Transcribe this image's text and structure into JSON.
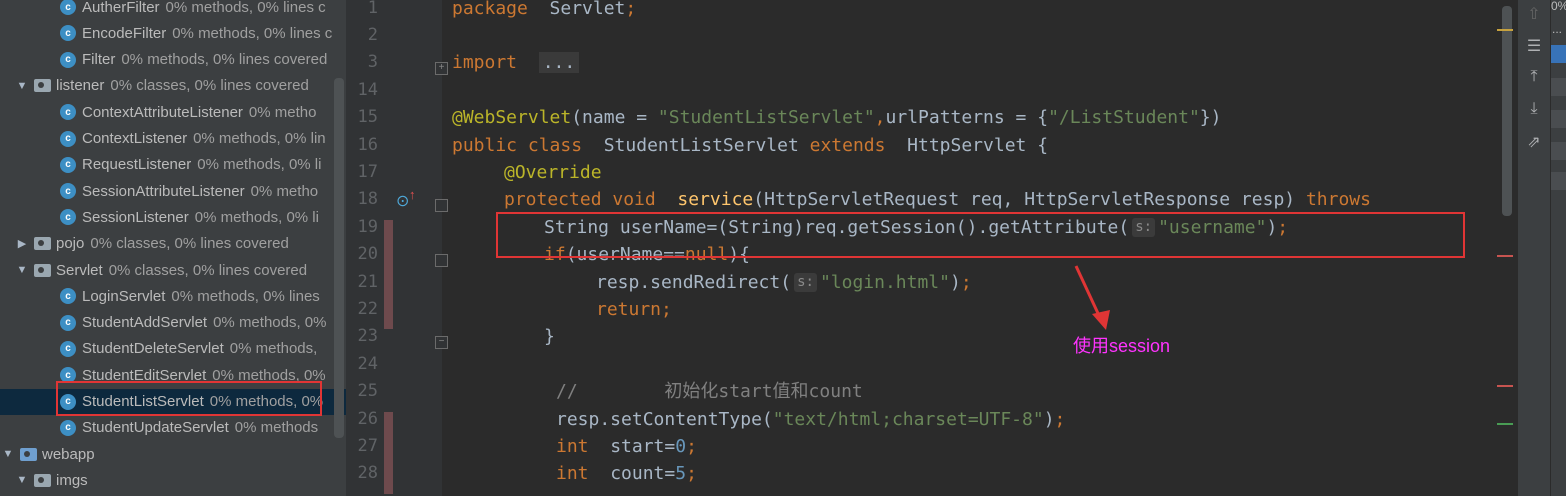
{
  "tree": {
    "items": [
      {
        "type": "class",
        "indent": 2,
        "name": "AutherFilter",
        "coverage": "0% methods, 0% lines c"
      },
      {
        "type": "class",
        "indent": 2,
        "name": "EncodeFilter",
        "coverage": "0% methods, 0% lines c"
      },
      {
        "type": "class",
        "indent": 2,
        "name": "Filter",
        "coverage": "0% methods, 0% lines covered"
      },
      {
        "type": "package",
        "indent": 1,
        "expanded": true,
        "name": "listener",
        "coverage": "0% classes, 0% lines covered"
      },
      {
        "type": "class",
        "indent": 2,
        "name": "ContextAttributeListener",
        "coverage": "0% metho"
      },
      {
        "type": "class",
        "indent": 2,
        "name": "ContextListener",
        "coverage": "0% methods, 0% lin"
      },
      {
        "type": "class",
        "indent": 2,
        "name": "RequestListener",
        "coverage": "0% methods, 0% li"
      },
      {
        "type": "class",
        "indent": 2,
        "name": "SessionAttributeListener",
        "coverage": "0% metho"
      },
      {
        "type": "class",
        "indent": 2,
        "name": "SessionListener",
        "coverage": "0% methods, 0% li"
      },
      {
        "type": "package",
        "indent": 1,
        "expanded": false,
        "name": "pojo",
        "coverage": "0% classes, 0% lines covered"
      },
      {
        "type": "package",
        "indent": 1,
        "expanded": true,
        "name": "Servlet",
        "coverage": "0% classes, 0% lines covered"
      },
      {
        "type": "class",
        "indent": 2,
        "name": "LoginServlet",
        "coverage": "0% methods, 0% lines"
      },
      {
        "type": "class",
        "indent": 2,
        "name": "StudentAddServlet",
        "coverage": "0% methods, 0%"
      },
      {
        "type": "class",
        "indent": 2,
        "name": "StudentDeleteServlet",
        "coverage": "0% methods,"
      },
      {
        "type": "class",
        "indent": 2,
        "name": "StudentEditServlet",
        "coverage": "0% methods, 0%"
      },
      {
        "type": "class",
        "indent": 2,
        "name": "StudentListServlet",
        "coverage": "0% methods, 0%",
        "selected": true
      },
      {
        "type": "class",
        "indent": 2,
        "name": "StudentUpdateServlet",
        "coverage": "0% methods"
      },
      {
        "type": "webfolder",
        "indent": 0,
        "expanded": true,
        "name": "webapp",
        "coverage": ""
      },
      {
        "type": "folder",
        "indent": 1,
        "expanded": true,
        "name": "imgs",
        "coverage": ""
      }
    ]
  },
  "gutter": {
    "line_numbers": [
      "1",
      "2",
      "3",
      "14",
      "15",
      "16",
      "17",
      "18",
      "19",
      "20",
      "21",
      "22",
      "23",
      "24",
      "25",
      "26",
      "27",
      "28"
    ]
  },
  "editor": {
    "lines": [
      [
        [
          "kw",
          "package"
        ],
        [
          "",
          "  Servlet"
        ],
        [
          "kw",
          ";"
        ]
      ],
      [],
      [
        [
          "kw",
          "import"
        ],
        [
          "",
          "  "
        ],
        [
          "fold",
          "..."
        ]
      ],
      [],
      [
        [
          "an",
          "@WebServlet"
        ],
        [
          "",
          "(name = "
        ],
        [
          "st",
          "\"StudentListServlet\""
        ],
        [
          "kw",
          ","
        ],
        [
          "",
          "urlPatterns = {"
        ],
        [
          "st",
          "\"/ListStudent\""
        ],
        [
          "",
          "})"
        ]
      ],
      [
        [
          "kw",
          "public class"
        ],
        [
          "",
          "  StudentListServlet "
        ],
        [
          "kw",
          "extends"
        ],
        [
          "",
          "  HttpServlet {"
        ]
      ],
      [
        [
          "",
          ""
        ],
        [
          "an",
          "@Override"
        ]
      ],
      [
        [
          "kw",
          "protected void"
        ],
        [
          "fn",
          "  service"
        ],
        [
          "",
          "(HttpServletRequest req, HttpServletResponse resp) "
        ],
        [
          "kw",
          "throws"
        ]
      ],
      [
        [
          "",
          "String userName=(String)req.getSession().getAttribute("
        ],
        [
          "hint",
          "s:"
        ],
        [
          "st",
          "\"username\""
        ],
        [
          "",
          ")"
        ],
        [
          "kw",
          ";"
        ]
      ],
      [
        [
          "kw",
          "if"
        ],
        [
          "",
          "(userName=="
        ],
        [
          "kw",
          "null"
        ],
        [
          "",
          "){"
        ]
      ],
      [
        [
          "",
          "resp.sendRedirect("
        ],
        [
          "hint",
          "s:"
        ],
        [
          "st",
          "\"login.html\""
        ],
        [
          "",
          ")"
        ],
        [
          "kw",
          ";"
        ]
      ],
      [
        [
          "kw",
          "return"
        ],
        [
          "kw",
          ";"
        ]
      ],
      [
        [
          "",
          "}"
        ]
      ],
      [],
      [
        [
          "cm",
          "//        初始化start值和count"
        ]
      ],
      [
        [
          "",
          "resp.setContentType("
        ],
        [
          "st",
          "\"text/html;charset=UTF-8\""
        ],
        [
          "",
          ")"
        ],
        [
          "kw",
          ";"
        ]
      ],
      [
        [
          "kw",
          "int"
        ],
        [
          "",
          "  start="
        ],
        [
          "nm",
          "0"
        ],
        [
          "kw",
          ";"
        ]
      ],
      [
        [
          "kw",
          "int"
        ],
        [
          "",
          "  count="
        ],
        [
          "nm",
          "5"
        ],
        [
          "kw",
          ";"
        ]
      ]
    ],
    "annotation": "使用session"
  },
  "right_edge": {
    "percent": "0%",
    "dots": "..."
  }
}
